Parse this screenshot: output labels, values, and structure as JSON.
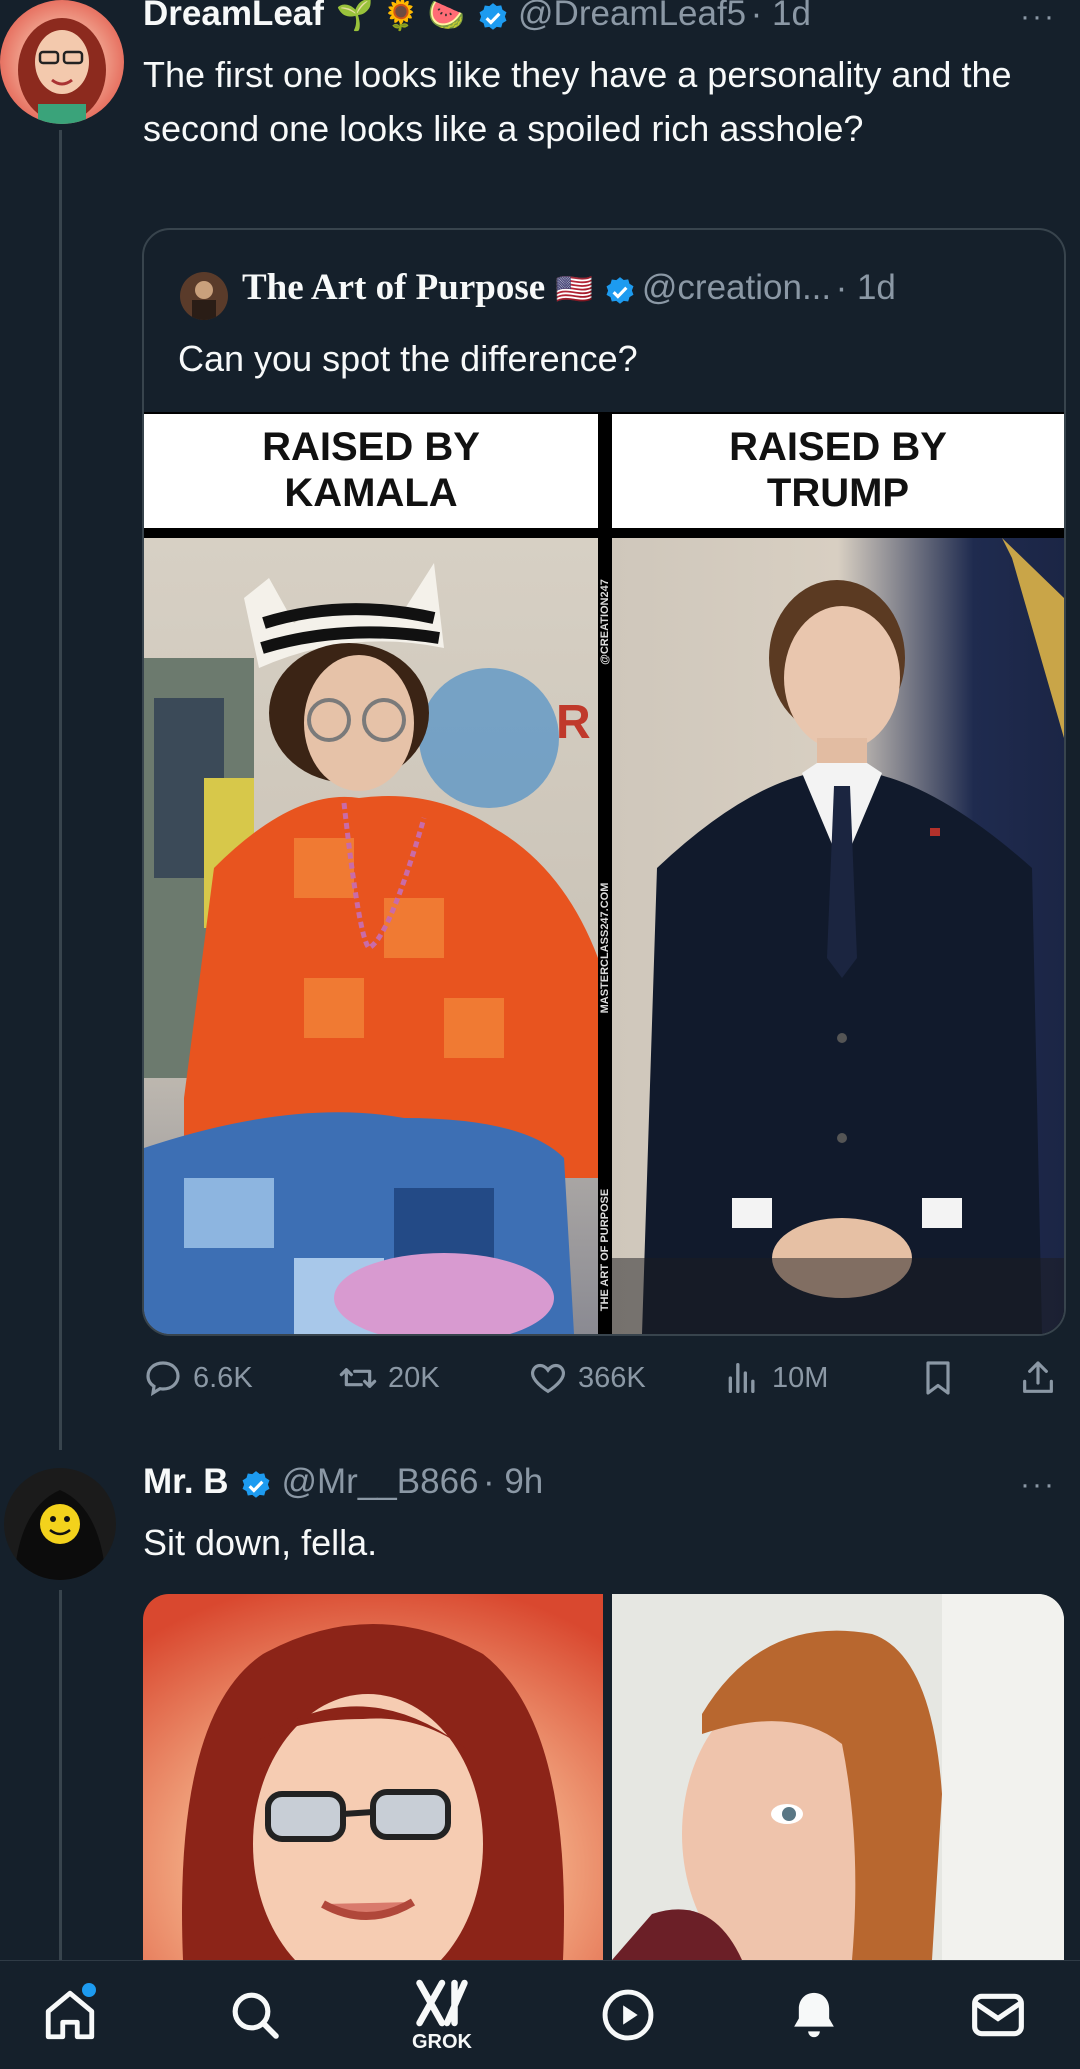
{
  "tweet1": {
    "display_name": "DreamLeaf",
    "name_emojis": "🌱 🌻 🍉",
    "handle": "@DreamLeaf5",
    "time": "· 1d",
    "more": "···",
    "text": "The first one looks like they have a personality and the second one looks like a spoiled rich asshole?",
    "quote": {
      "display_name": "The Art of Purpose",
      "flag": "🇺🇸",
      "handle": "@creation...",
      "time": "· 1d",
      "text": "Can you spot the difference?",
      "left_label_line1": "RAISED BY",
      "left_label_line2": "KAMALA",
      "right_label_line1": "RAISED BY",
      "right_label_line2": "TRUMP",
      "watermark_top": "@CREATION247",
      "watermark_mid": "MASTERCLASS247.COM",
      "watermark_bottom": "THE ART OF PURPOSE"
    },
    "actions": {
      "replies": "6.6K",
      "reposts": "20K",
      "likes": "366K",
      "views": "10M"
    }
  },
  "tweet2": {
    "display_name": "Mr. B",
    "handle": "@Mr__B866",
    "time": "· 9h",
    "more": "···",
    "text": "Sit down, fella."
  },
  "nav": {
    "grok_label": "GROK",
    "items": [
      "home-icon",
      "search-icon",
      "grok-icon",
      "video-icon",
      "notifications-icon",
      "messages-icon"
    ]
  },
  "colors": {
    "background": "#15202b",
    "text_secondary": "#8b98a5",
    "verified_blue": "#1d9bf0",
    "border": "#38444d"
  }
}
